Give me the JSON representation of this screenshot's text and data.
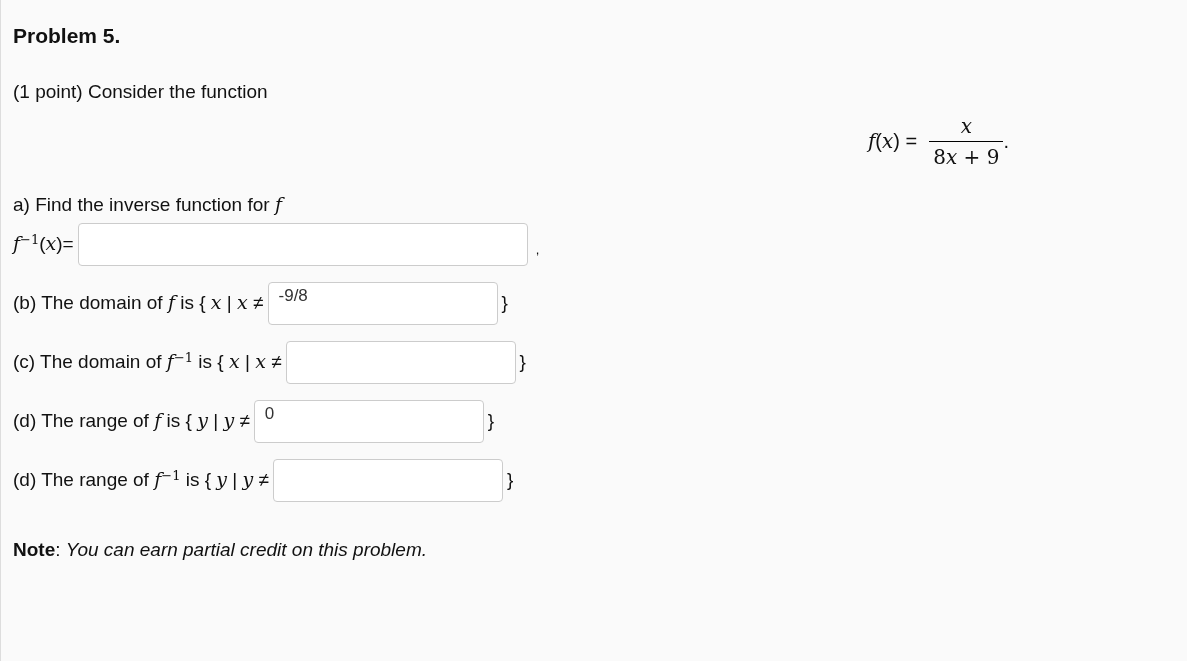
{
  "title": "Problem 5.",
  "intro": "(1 point) Consider the function",
  "formula": {
    "lhs": "*f*(*x*) =",
    "numerator": "*x*",
    "denominator": {
      "coefficient": "8",
      "variable": "x",
      "rest": "+ 9"
    },
    "end": "."
  },
  "question": "a) Find the inverse function for *f*",
  "parts": [
    {
      "kind": "wide",
      "prompt": "*f*$^{−1}$(*x*)=",
      "suffix": ","
    },
    {
      "kind": "normal",
      "prompt": "(b) The domain of *f* is { *x* | *x* ≠",
      "value": "-9/8",
      "suffix": "}"
    },
    {
      "kind": "normal",
      "prompt": "(c) The domain of *f*$^{−1}$ is { *x* | *x* ≠",
      "suffix": "}"
    },
    {
      "kind": "normal",
      "prompt": "(d) The range of *f* is { *y* | *y* ≠",
      "value": "0",
      "suffix": "}"
    },
    {
      "kind": "normal",
      "prompt": "(d) The range of *f*$^{−1}$ is { *y* | *y* ≠",
      "suffix": "}"
    }
  ],
  "note": "**Note**: *You can earn partial credit on this problem.*"
}
